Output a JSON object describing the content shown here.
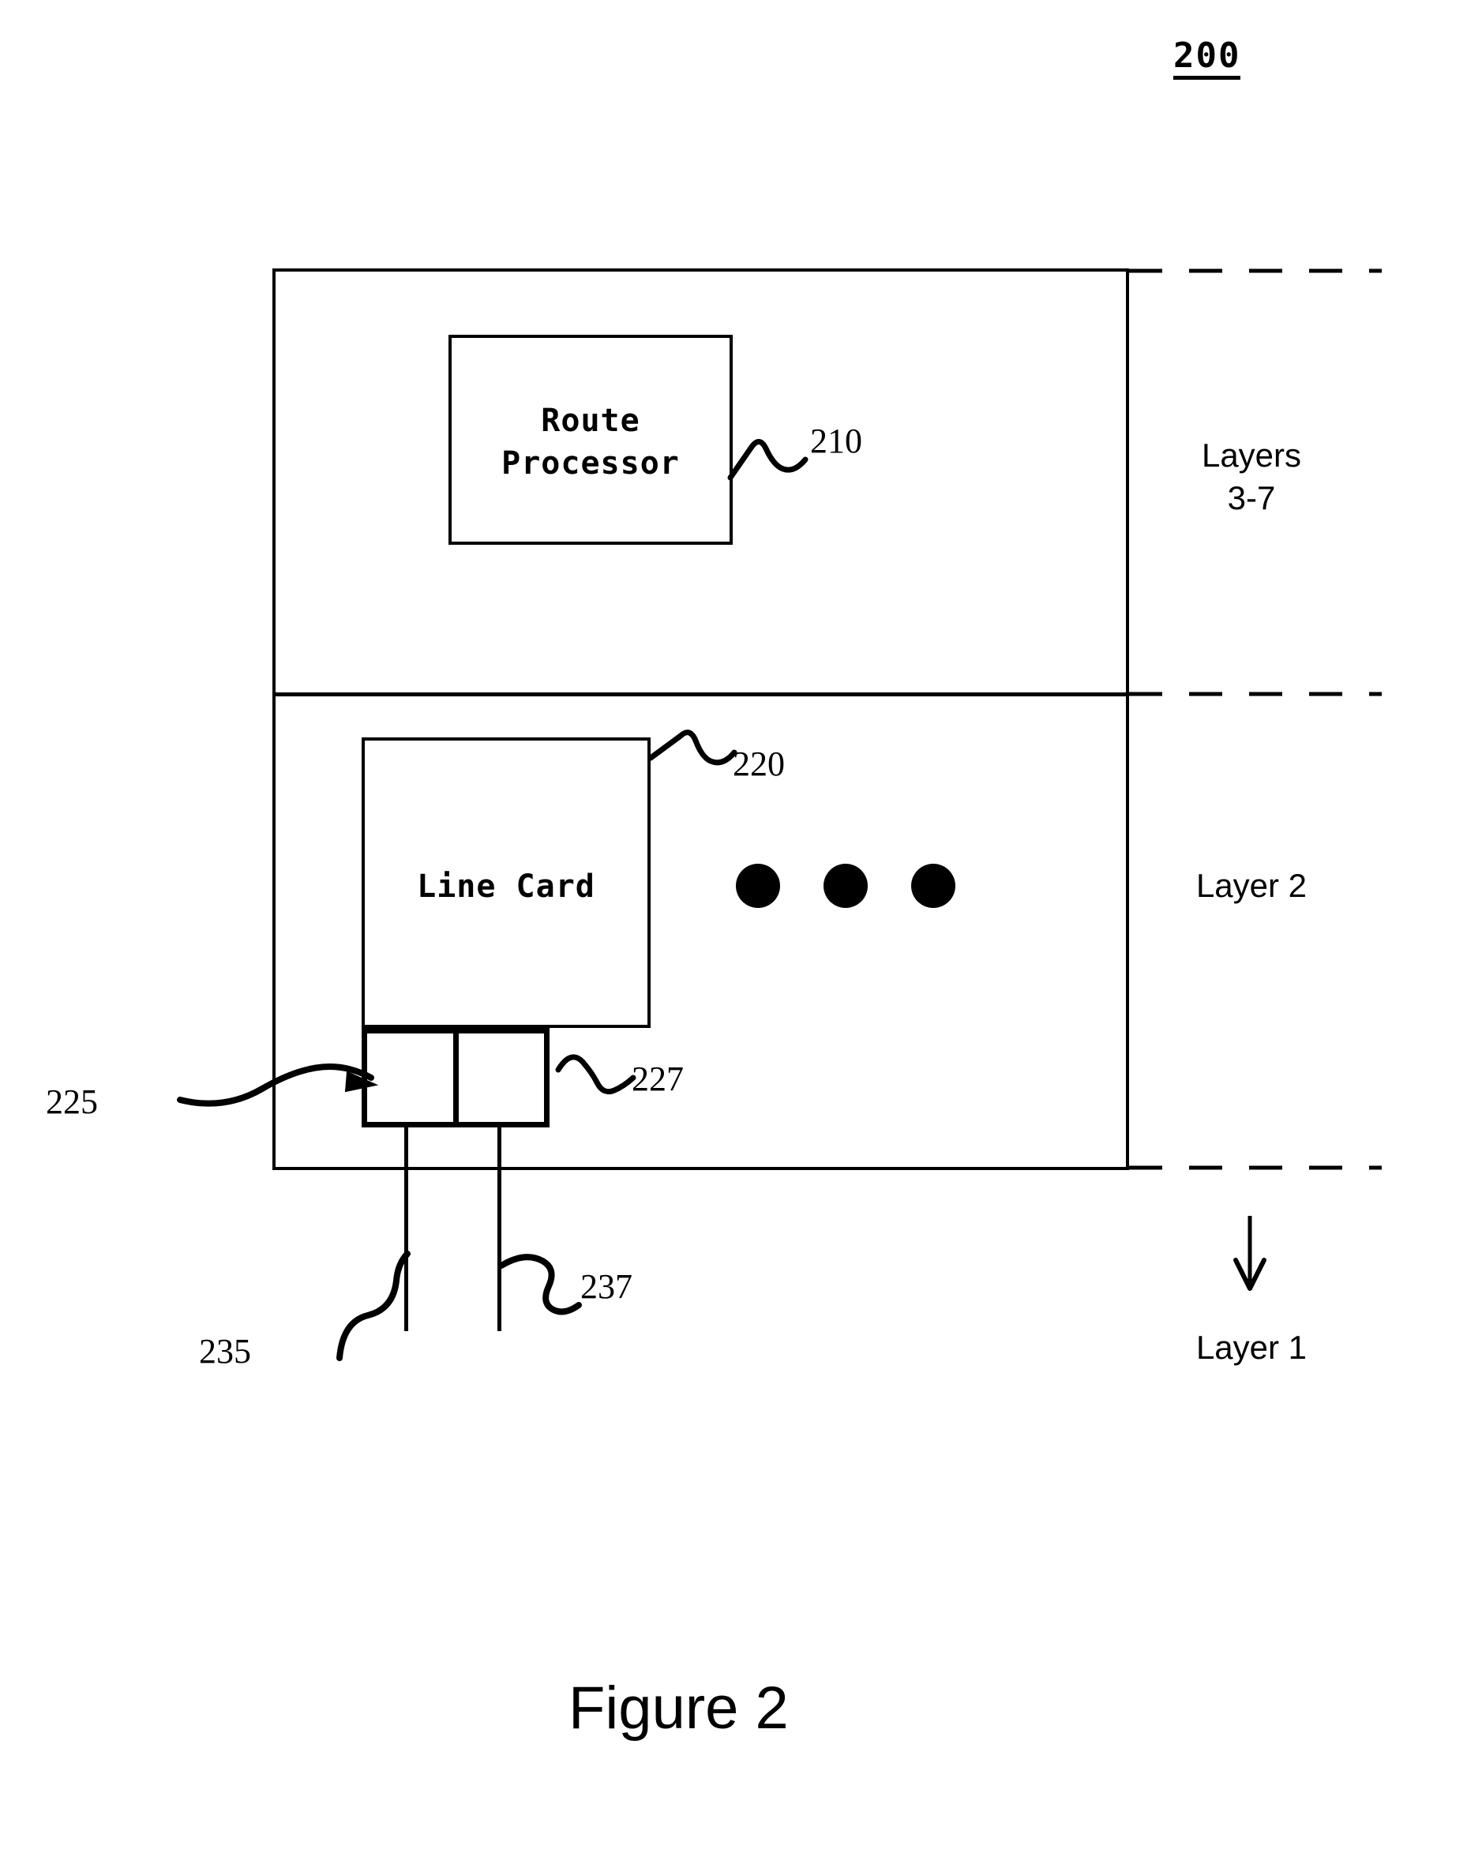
{
  "figure": {
    "number_label": "200",
    "caption": "Figure 2"
  },
  "chassis": {
    "name": "network-router-chassis",
    "sections": [
      {
        "key": "upper",
        "layer_label": "Layers\n3-7"
      },
      {
        "key": "lower",
        "layer_label": "Layer 2"
      }
    ],
    "external_layer_label": "Layer 1"
  },
  "blocks": {
    "route_processor": {
      "label": "Route\nProcessor",
      "ref": "210"
    },
    "line_card": {
      "label": "Line Card",
      "ref": "220"
    },
    "ports": {
      "ref": "227",
      "count": 2
    }
  },
  "refs": {
    "route_processor": "210",
    "line_card": "220",
    "line_card_interface": "225",
    "ports": "227",
    "link_left": "235",
    "link_right": "237"
  },
  "ellipsis": {
    "label": "",
    "dot_count": 3
  }
}
